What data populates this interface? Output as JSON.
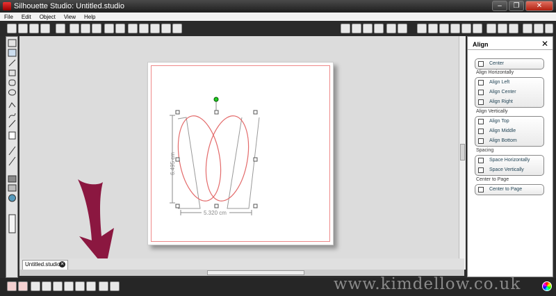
{
  "window": {
    "title": "Silhouette Studio: Untitled.studio",
    "buttons": [
      "–",
      "❐",
      "✕"
    ]
  },
  "menu": [
    "File",
    "Edit",
    "Object",
    "View",
    "Help"
  ],
  "tab": {
    "label": "Untitled.studio"
  },
  "shape": {
    "height_label": "6.495 cm",
    "width_label": "5.320 cm",
    "stroke_color": "#e36a6a"
  },
  "arrow": {
    "color": "#8b1740"
  },
  "watermark": "www.kimdellow.co.uk",
  "align_panel": {
    "title": "Align",
    "center": "Center",
    "sections": [
      {
        "label": "Align Horizontally",
        "items": [
          "Align Left",
          "Align Center",
          "Align Right"
        ]
      },
      {
        "label": "Align Vertically",
        "items": [
          "Align Top",
          "Align Middle",
          "Align Bottom"
        ]
      },
      {
        "label": "Spacing",
        "items": [
          "Space Horizontally",
          "Space Vertically"
        ]
      },
      {
        "label": "Center to Page",
        "items": [
          "Center to Page"
        ]
      }
    ]
  }
}
